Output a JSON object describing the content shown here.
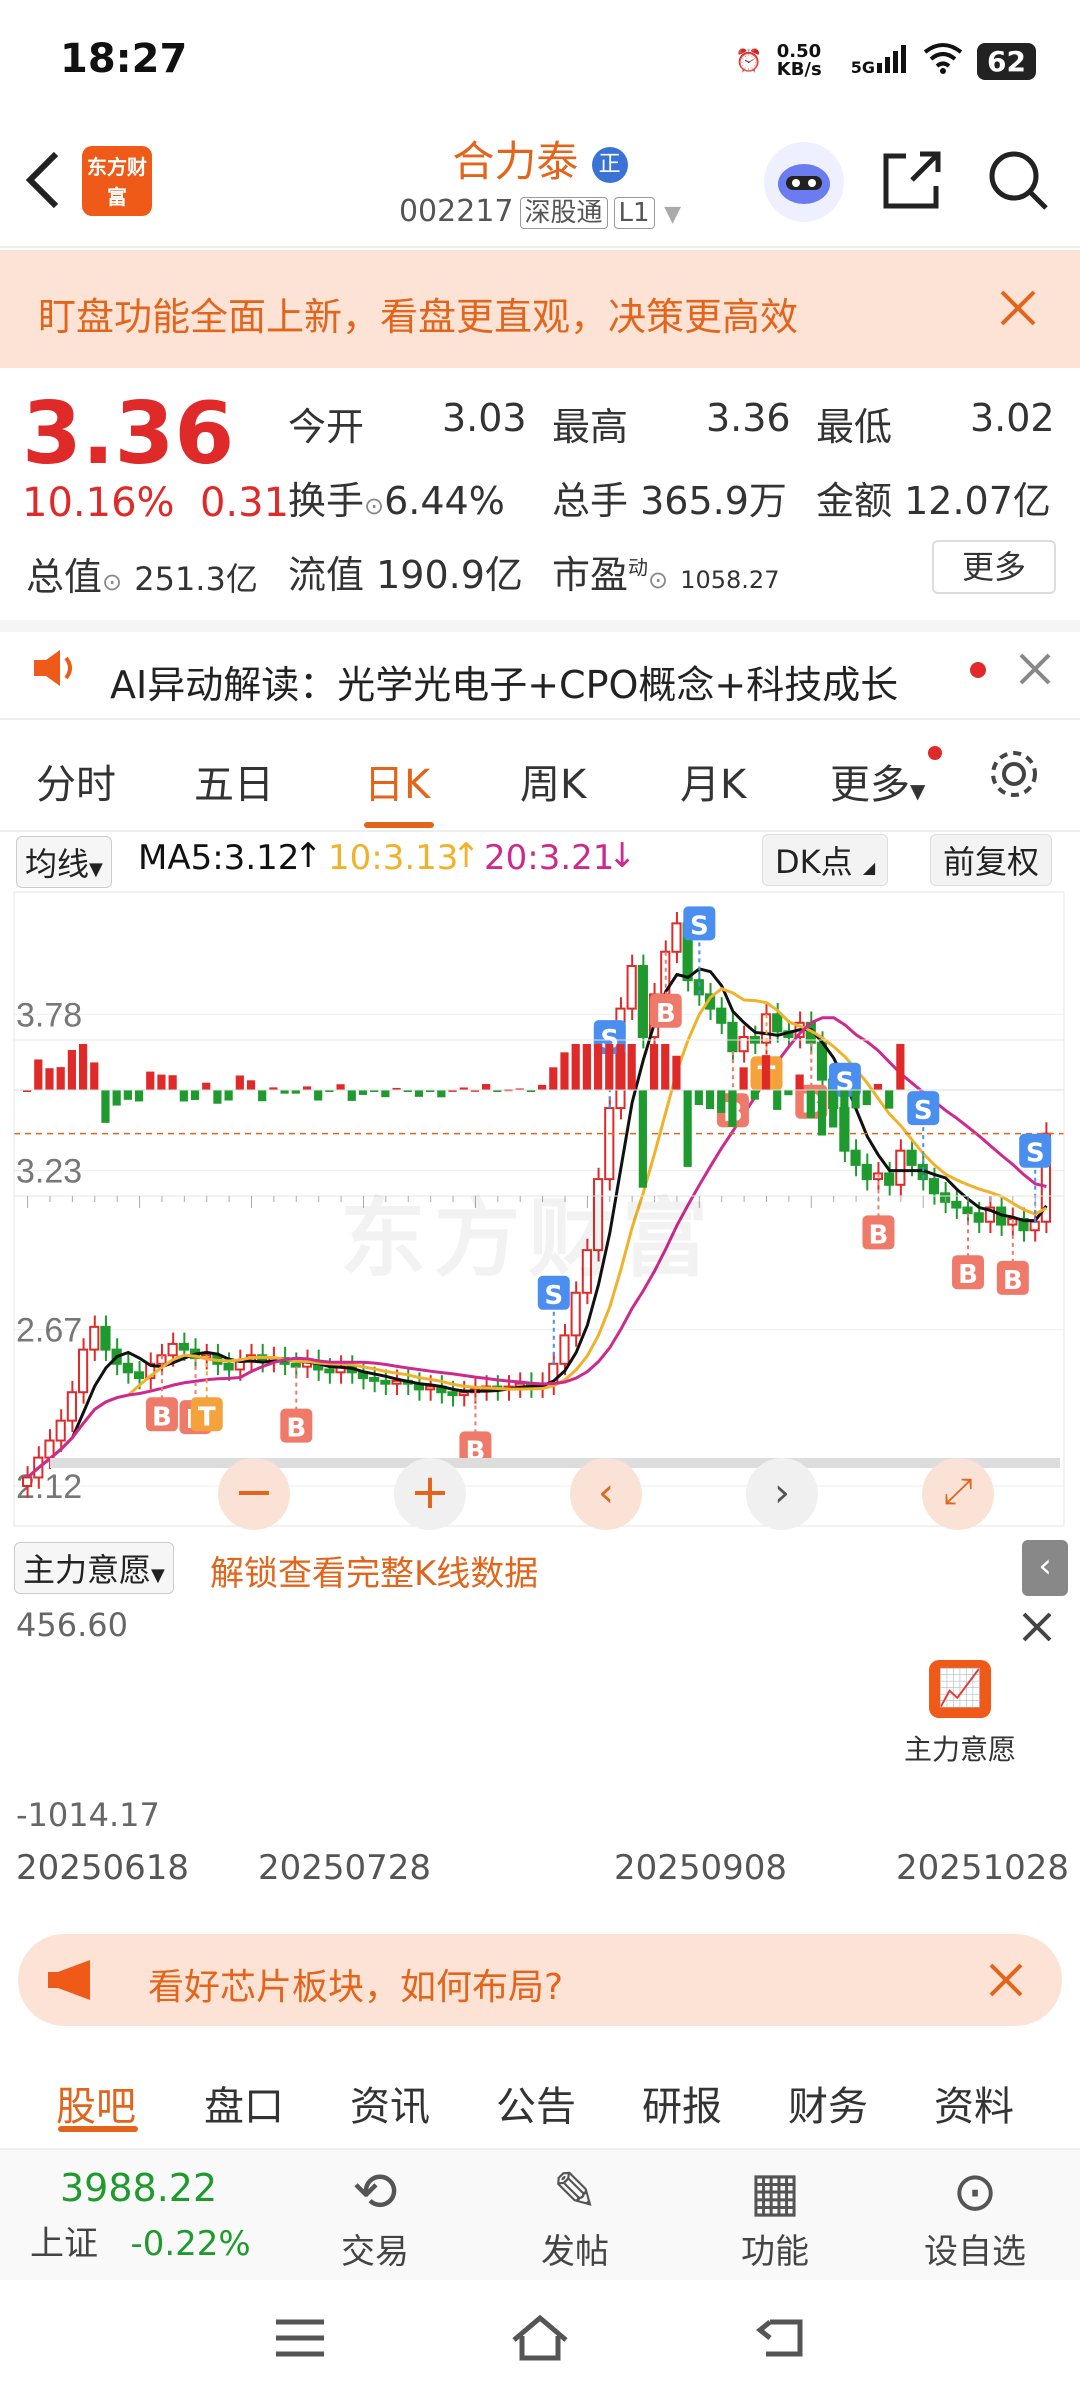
{
  "status": {
    "time": "18:27",
    "net_speed": "0.50 KB/s",
    "signal": "5G",
    "battery": "62"
  },
  "header": {
    "logo": "东方财富",
    "name": "合力泰",
    "name_badge": "正",
    "code": "002217",
    "tag1": "深股通",
    "tag2": "L1"
  },
  "banner": {
    "text": "盯盘功能全面上新，看盘更直观，决策更高效"
  },
  "quote": {
    "price": "3.36",
    "pct": "10.16%",
    "chg": "0.31",
    "open_label": "今开",
    "open": "3.03",
    "high_label": "最高",
    "high": "3.36",
    "low_label": "最低",
    "low": "3.02",
    "turnover_label": "换手",
    "turnover": "6.44%",
    "vol_label": "总手",
    "vol": "365.9万",
    "amount_label": "金额",
    "amount": "12.07亿",
    "mcap_label": "总值",
    "mcap": "251.3亿",
    "float_label": "流值",
    "float": "190.9亿",
    "pe_label": "市盈",
    "pe_sup": "动",
    "pe": "1058.27",
    "more": "更多"
  },
  "ai": {
    "text": "AI异动解读：光学光电子+CPO概念+科技成长"
  },
  "tabs": [
    "分时",
    "五日",
    "日K",
    "周K",
    "月K",
    "更多"
  ],
  "chart_bar": {
    "ma_select": "均线",
    "ma5": "MA5:3.12",
    "ma10": "10:3.13",
    "ma20": "20:3.21",
    "dk": "DK点",
    "adjust": "前复权"
  },
  "colors": {
    "up": "#e02a2a",
    "down": "#1f9a2e",
    "accent": "#e2651b",
    "ma5": "#111111",
    "ma10": "#f0b22a",
    "ma20": "#cc2a8e"
  },
  "chart_data": {
    "type": "candlestick",
    "ylim": [
      2.12,
      4.33
    ],
    "yticks": [
      "4.33",
      "3.78",
      "3.23",
      "2.67",
      "2.12"
    ],
    "close": [
      2.15,
      2.22,
      2.28,
      2.35,
      2.45,
      2.6,
      2.68,
      2.6,
      2.55,
      2.52,
      2.5,
      2.55,
      2.58,
      2.62,
      2.6,
      2.57,
      2.58,
      2.55,
      2.53,
      2.56,
      2.58,
      2.56,
      2.57,
      2.55,
      2.54,
      2.56,
      2.53,
      2.52,
      2.54,
      2.52,
      2.5,
      2.49,
      2.48,
      2.49,
      2.48,
      2.46,
      2.47,
      2.45,
      2.44,
      2.45,
      2.46,
      2.47,
      2.46,
      2.47,
      2.48,
      2.47,
      2.48,
      2.55,
      2.65,
      2.8,
      2.95,
      3.2,
      3.45,
      3.8,
      3.95,
      3.7,
      3.85,
      4.0,
      4.1,
      3.9,
      3.85,
      3.8,
      3.75,
      3.65,
      3.7,
      3.68,
      3.78,
      3.72,
      3.7,
      3.75,
      3.68,
      3.55,
      3.45,
      3.3,
      3.25,
      3.2,
      3.22,
      3.18,
      3.3,
      3.25,
      3.2,
      3.15,
      3.12,
      3.1,
      3.08,
      3.05,
      3.1,
      3.04,
      3.06,
      3.02,
      3.05,
      3.36
    ],
    "annotations": [
      "B",
      "B",
      "T",
      "B",
      "B",
      "S",
      "S",
      "B",
      "S",
      "B",
      "T",
      "B",
      "S",
      "B",
      "S",
      "B",
      "B",
      "S"
    ],
    "indicator": {
      "name": "主力意愿",
      "max": "456.60",
      "min": "-1014.17",
      "unlock": "解锁查看完整K线数据",
      "badge": "主力意愿"
    },
    "x_labels": [
      "20250618",
      "20250728",
      "20250908",
      "20251028"
    ]
  },
  "watermark": "东方财富",
  "promo": {
    "text": "看好芯片板块，如何布局?"
  },
  "bottom_tabs": [
    "股吧",
    "盘口",
    "资讯",
    "公告",
    "研报",
    "财务",
    "资料"
  ],
  "index": {
    "value": "3988.22",
    "name": "上证",
    "pct": "-0.22%"
  },
  "nav": [
    {
      "label": "交易",
      "icon": "yen-cycle-icon"
    },
    {
      "label": "发帖",
      "icon": "edit-icon"
    },
    {
      "label": "功能",
      "icon": "grid-icon"
    },
    {
      "label": "设自选",
      "icon": "more-circle-icon"
    }
  ]
}
